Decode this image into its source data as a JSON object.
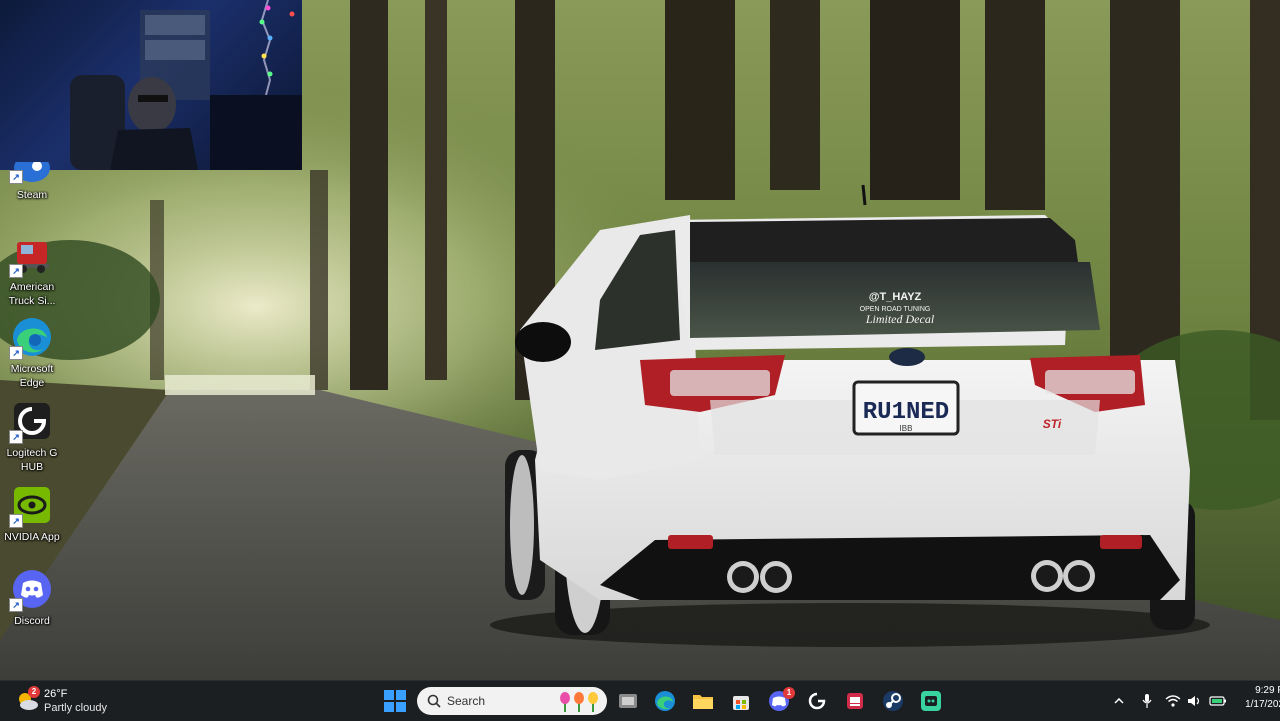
{
  "desktop_icons": [
    {
      "id": "steam",
      "label": "Steam"
    },
    {
      "id": "american-truck",
      "label": "American Truck Si..."
    },
    {
      "id": "edge",
      "label": "Microsoft Edge"
    },
    {
      "id": "logitech",
      "label": "Logitech G HUB"
    },
    {
      "id": "nvidia",
      "label": "NVIDIA App"
    },
    {
      "id": "discord",
      "label": "Discord"
    }
  ],
  "wallpaper": {
    "license_plate": "RU1NED",
    "plate_bottom": "IBB",
    "decal_line1": "@T_HAYZ",
    "decal_line2": "OPEN ROAD TUNING",
    "decal_line3": "Limited Decal",
    "badge": "STi"
  },
  "taskbar": {
    "weather": {
      "temp": "26°F",
      "condition": "Partly cloudy",
      "badge": "2"
    },
    "search_placeholder": "Search",
    "discord_badge": "1",
    "clock": {
      "time": "9:29 P",
      "date": "1/17/202"
    }
  },
  "colors": {
    "taskbar_bg": "#1c1f22",
    "search_bg": "#f2f2f2",
    "badge": "#e23a3a"
  }
}
